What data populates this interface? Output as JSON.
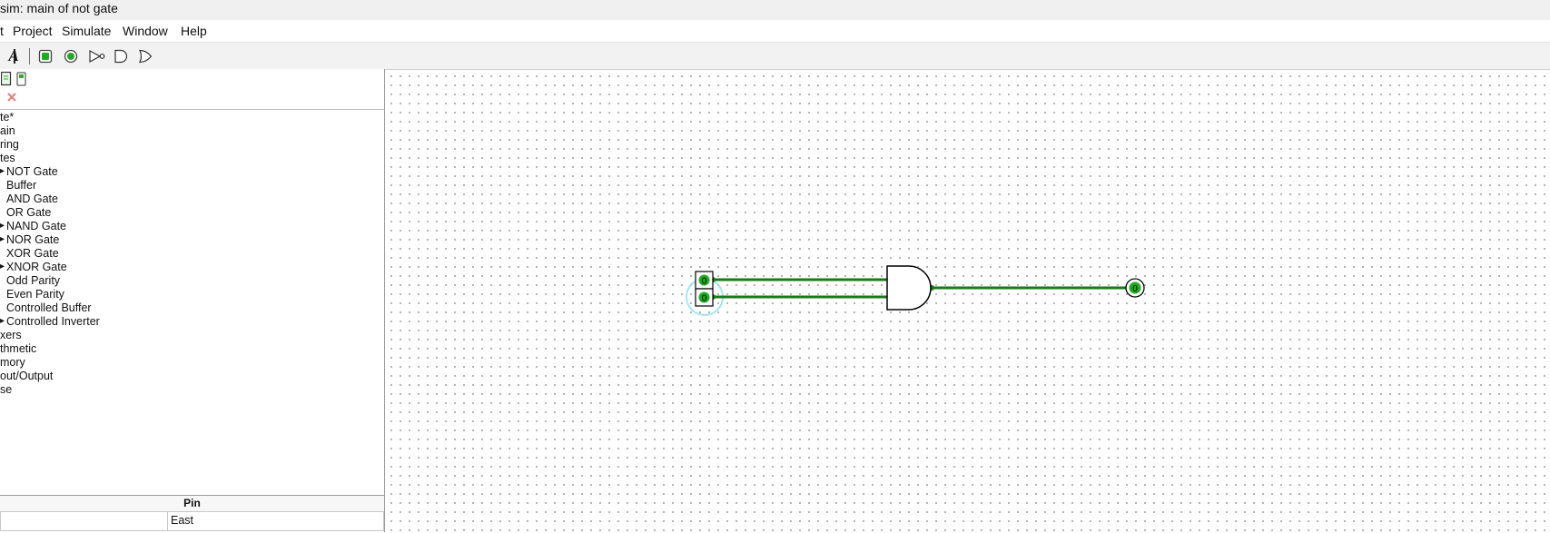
{
  "window": {
    "title": "sim: main of not gate"
  },
  "menu": [
    "t",
    "Project",
    "Simulate",
    "Window",
    "Help"
  ],
  "toolbar": {
    "text_tool": "A"
  },
  "explorer": {
    "items": [
      {
        "label": "te*",
        "level": 0
      },
      {
        "label": "ain",
        "level": 0
      },
      {
        "label": "ring",
        "level": 0
      },
      {
        "label": "tes",
        "level": 0
      },
      {
        "label": "NOT Gate",
        "level": 1
      },
      {
        "label": "Buffer",
        "level": 1
      },
      {
        "label": "AND Gate",
        "level": 1
      },
      {
        "label": "OR Gate",
        "level": 1
      },
      {
        "label": "NAND Gate",
        "level": 1
      },
      {
        "label": "NOR Gate",
        "level": 1
      },
      {
        "label": "XOR Gate",
        "level": 1
      },
      {
        "label": "XNOR Gate",
        "level": 1
      },
      {
        "label": "Odd Parity",
        "level": 1
      },
      {
        "label": "Even Parity",
        "level": 1
      },
      {
        "label": "Controlled Buffer",
        "level": 1
      },
      {
        "label": "Controlled Inverter",
        "level": 1
      },
      {
        "label": "xers",
        "level": 0
      },
      {
        "label": "thmetic",
        "level": 0
      },
      {
        "label": "mory",
        "level": 0
      },
      {
        "label": "out/Output",
        "level": 0
      },
      {
        "label": "se",
        "level": 0
      }
    ]
  },
  "attributes": {
    "title": "Pin",
    "row_value": "East"
  },
  "circuit": {
    "input_pin_1_value": "0",
    "input_pin_2_value": "0",
    "output_pin_value": "0",
    "wire_color": "#1a7a1a"
  },
  "colors": {
    "active_green": "#22aa22",
    "wire": "#1a7a1a",
    "highlight": "#8fe0ee",
    "delete_red": "#e08080"
  }
}
